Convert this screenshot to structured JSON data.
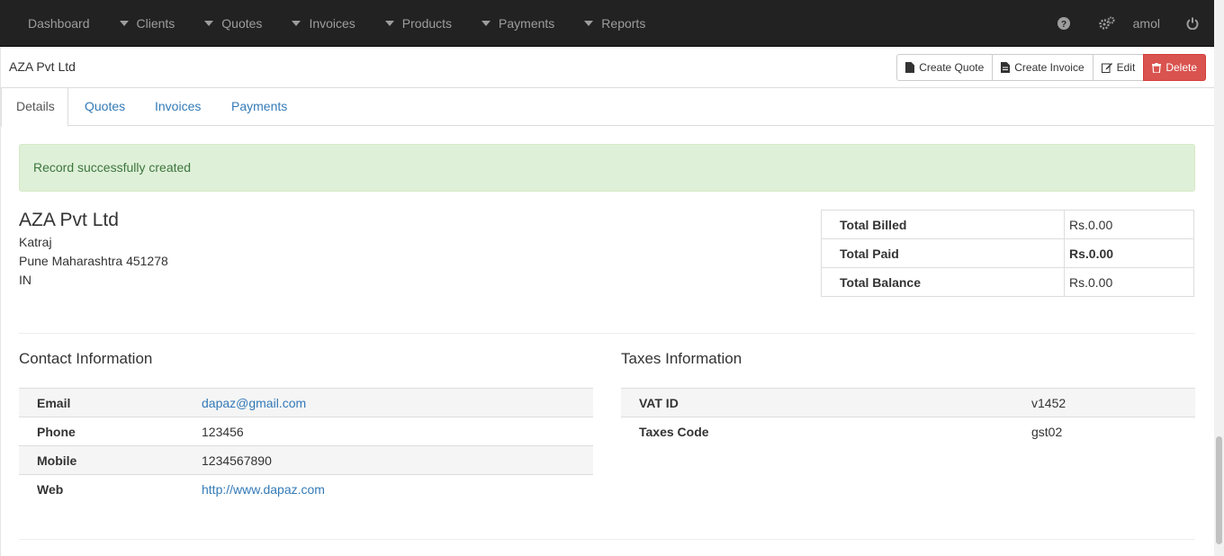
{
  "nav": {
    "dashboard": "Dashboard",
    "clients": "Clients",
    "quotes": "Quotes",
    "invoices": "Invoices",
    "products": "Products",
    "payments": "Payments",
    "reports": "Reports",
    "user": "amol",
    "icons": [
      "question-circle-icon",
      "cogs-icon",
      "power-off-icon"
    ]
  },
  "header": {
    "title": "AZA Pvt Ltd",
    "buttons": {
      "create_quote": "Create Quote",
      "create_invoice": "Create Invoice",
      "edit": "Edit",
      "delete": "Delete"
    }
  },
  "tabs": [
    "Details",
    "Quotes",
    "Invoices",
    "Payments"
  ],
  "alert": {
    "message": "Record successfully created",
    "color": "#dff0d8"
  },
  "client": {
    "name": "AZA Pvt Ltd",
    "address1": "Katraj",
    "city_state_zip": "Pune Maharashtra 451278",
    "country": "IN"
  },
  "totals": [
    {
      "label": "Total Billed",
      "value": "Rs.0.00"
    },
    {
      "label": "Total Paid",
      "value": "Rs.0.00"
    },
    {
      "label": "Total Balance",
      "value": "Rs.0.00"
    }
  ],
  "contact": {
    "title": "Contact Information",
    "rows": [
      {
        "label": "Email",
        "value": "dapaz@gmail.com"
      },
      {
        "label": "Phone",
        "value": "123456"
      },
      {
        "label": "Mobile",
        "value": "1234567890"
      },
      {
        "label": "Web",
        "value": "http://www.dapaz.com"
      }
    ]
  },
  "taxes": {
    "title": "Taxes Information",
    "rows": [
      {
        "label": "VAT ID",
        "value": "v1452"
      },
      {
        "label": "Taxes Code",
        "value": "gst02"
      }
    ]
  },
  "colors": {
    "navbar": "#222222",
    "link": "#337ab7",
    "danger": "#d9534f"
  }
}
